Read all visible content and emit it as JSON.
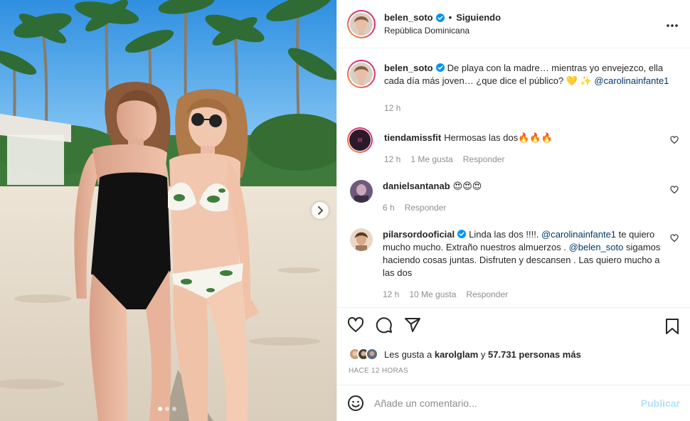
{
  "post": {
    "username": "belen_soto",
    "follow_state": "Siguiendo",
    "separator": "•",
    "location": "República Dominicana"
  },
  "caption": {
    "username": "belen_soto",
    "text": "De playa con la madre… mientras yo envejezco, ella cada día más joven… ¿que dice el público? 💛 ✨ ",
    "mention": "@carolinainfante1",
    "time": "12 h"
  },
  "comments": [
    {
      "username": "tiendamissfit",
      "text": "Hermosas las dos🔥🔥🔥",
      "time": "12 h",
      "likes": "1 Me gusta",
      "reply": "Responder"
    },
    {
      "username": "danielsantanab",
      "text": "😍😍😍",
      "time": "6 h",
      "reply": "Responder"
    },
    {
      "username": "pilarsordooficial",
      "text_a": "Linda las dos !!!!. ",
      "mention_a": "@carolinainfante1",
      "text_b": " te quiero mucho mucho. Extraño nuestros almuerzos . ",
      "mention_b": "@belen_soto",
      "text_c": " sigamos haciendo cosas juntas. Disfruten y descansen . Las quiero mucho a las dos",
      "time": "12 h",
      "likes": "10 Me gusta",
      "reply": "Responder"
    }
  ],
  "likes": {
    "prefix": "Les gusta a",
    "user": "karolglam",
    "joiner": "y",
    "count": "57.731 personas más"
  },
  "time_ago": "HACE 12 HORAS",
  "composer": {
    "placeholder": "Añade un comentario...",
    "publish": "Publicar"
  },
  "carousel": {
    "slides": 3,
    "active": 1
  },
  "icons": {
    "verified": "verified-badge-icon",
    "more": "more-options-icon",
    "heart": "heart-icon",
    "comment": "comment-icon",
    "share": "share-icon",
    "save": "bookmark-icon",
    "emoji": "emoji-icon",
    "next": "chevron-right-icon"
  },
  "colors": {
    "verified": "#0095f6",
    "mention": "#00376b",
    "muted": "#8e8e8e",
    "publish_disabled": "#b2dffc"
  }
}
